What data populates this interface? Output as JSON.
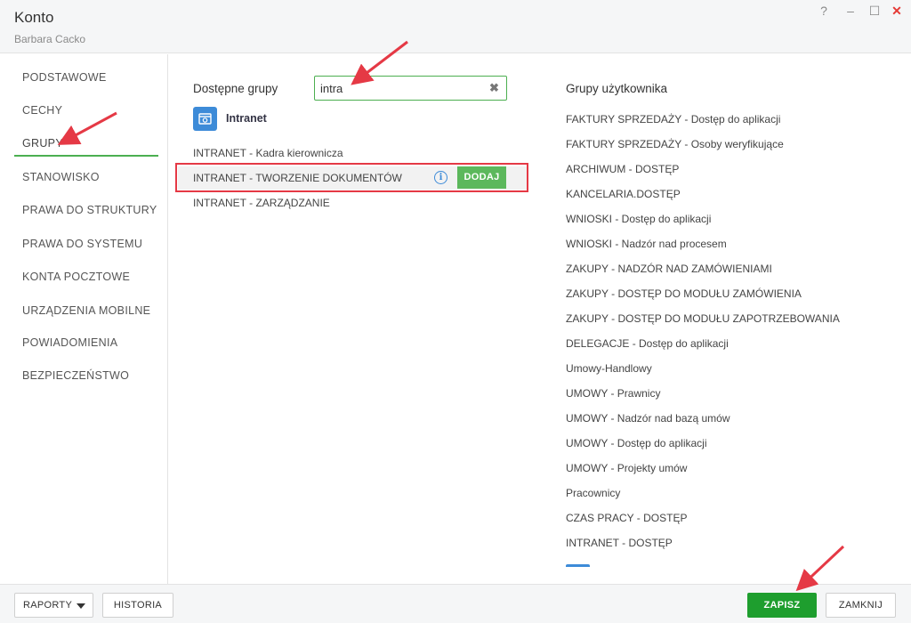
{
  "window": {
    "title": "Konto",
    "subtitle": "Barbara Cacko",
    "controls": {
      "help": "?",
      "minimize": "–",
      "maximize": "☐",
      "close": "✕"
    }
  },
  "sidebar": {
    "items": [
      {
        "label": "PODSTAWOWE"
      },
      {
        "label": "CECHY"
      },
      {
        "label": "GRUPY",
        "active": true
      },
      {
        "label": "STANOWISKO"
      },
      {
        "label": "PRAWA DO STRUKTURY"
      },
      {
        "label": "PRAWA DO SYSTEMU"
      },
      {
        "label": "KONTA POCZTOWE"
      },
      {
        "label": "URZĄDZENIA MOBILNE"
      },
      {
        "label": "POWIADOMIENIA"
      },
      {
        "label": "BEZPIECZEŃSTWO"
      }
    ]
  },
  "available_groups": {
    "label": "Dostępne grupy",
    "search": {
      "value": "intra",
      "clear_icon": "✖"
    },
    "app": {
      "name": "Intranet",
      "icon": "intranet-app-icon"
    },
    "rows": [
      {
        "label": "INTRANET - Kadra kierownicza"
      },
      {
        "label": "INTRANET - TWORZENIE DOKUMENTÓW",
        "highlighted": true
      },
      {
        "label": "INTRANET - ZARZĄDZANIE"
      }
    ],
    "info_icon": "i",
    "add_label": "DODAJ"
  },
  "user_groups": {
    "label": "Grupy użytkownika",
    "items": [
      "FAKTURY SPRZEDAŻY - Dostęp do aplikacji",
      "FAKTURY SPRZEDAŻY - Osoby weryfikujące",
      "ARCHIWUM - DOSTĘP",
      "KANCELARIA.DOSTĘP",
      "WNIOSKI - Dostęp do aplikacji",
      "WNIOSKI - Nadzór nad procesem",
      "ZAKUPY - NADZÓR NAD ZAMÓWIENIAMI",
      "ZAKUPY - DOSTĘP DO MODUŁU ZAMÓWIENIA",
      "ZAKUPY - DOSTĘP DO MODUŁU ZAPOTRZEBOWANIA",
      "DELEGACJE - Dostęp do aplikacji",
      "Umowy-Handlowy",
      "UMOWY - Prawnicy",
      "UMOWY - Nadzór nad bazą umów",
      "UMOWY - Dostęp do aplikacji",
      "UMOWY - Projekty umów",
      "Pracownicy",
      "CZAS PRACY - DOSTĘP",
      "INTRANET - DOSTĘP"
    ]
  },
  "footer": {
    "reports_label": "RAPORTY",
    "history_label": "HISTORIA",
    "save_label": "ZAPISZ",
    "close_label": "ZAMKNIJ"
  },
  "colors": {
    "accent_green": "#4caf50",
    "save_green": "#1e9e2e",
    "add_green": "#5cb85c",
    "annotation_red": "#e53945",
    "app_blue": "#3d8bd8"
  }
}
